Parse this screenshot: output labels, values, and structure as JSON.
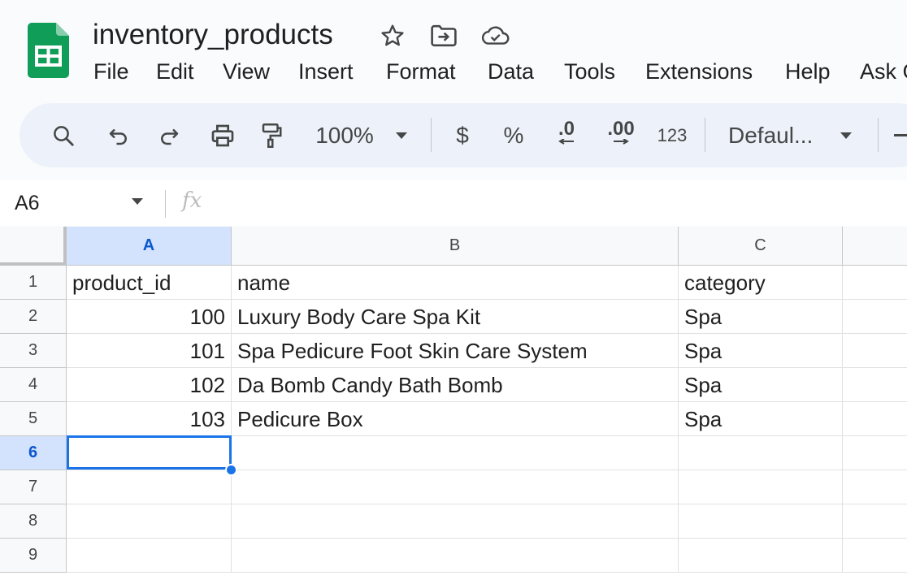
{
  "header": {
    "title": "inventory_products",
    "menus": [
      "File",
      "Edit",
      "View",
      "Insert",
      "Format",
      "Data",
      "Tools",
      "Extensions",
      "Help",
      "Ask G"
    ]
  },
  "toolbar": {
    "zoom": "100%",
    "currency": "$",
    "percent": "%",
    "decrease_decimal": ".0",
    "increase_decimal": ".00",
    "number_format": "123",
    "font": "Defaul..."
  },
  "formula_bar": {
    "cell_ref": "A6",
    "fx": "fx",
    "value": ""
  },
  "sheet": {
    "columns": [
      {
        "label": "A",
        "selected": true
      },
      {
        "label": "B",
        "selected": false
      },
      {
        "label": "C",
        "selected": false
      }
    ],
    "row_numbers": [
      "1",
      "2",
      "3",
      "4",
      "5",
      "6",
      "7",
      "8",
      "9"
    ],
    "active_row": "6",
    "rows": [
      [
        "product_id",
        "name",
        "category"
      ],
      [
        "100",
        "Luxury Body Care Spa Kit",
        "Spa"
      ],
      [
        "101",
        "Spa Pedicure Foot Skin Care System",
        "Spa"
      ],
      [
        "102",
        "Da Bomb Candy Bath Bomb",
        "Spa"
      ],
      [
        "103",
        "Pedicure Box",
        "Spa"
      ],
      [
        "",
        "",
        ""
      ],
      [
        "",
        "",
        ""
      ],
      [
        "",
        "",
        ""
      ],
      [
        "",
        "",
        ""
      ]
    ]
  },
  "colors": {
    "accent": "#1a73e8",
    "logo_green": "#0f9d58",
    "selection": "#d3e3fd"
  }
}
